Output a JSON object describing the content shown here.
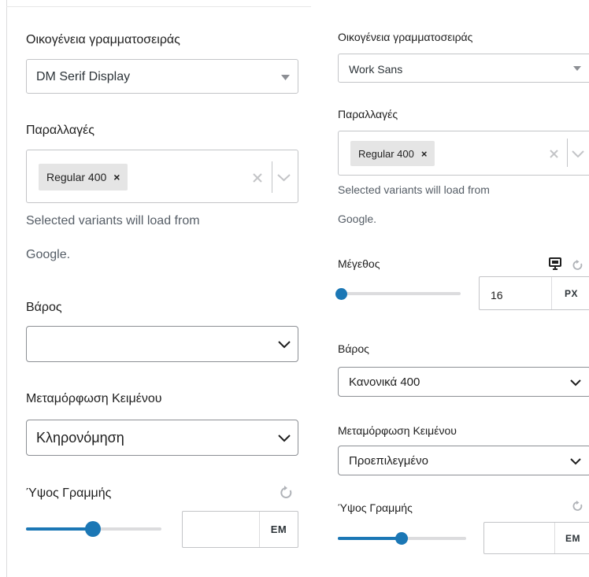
{
  "left": {
    "font_family": {
      "label": "Οικογένεια γραμματοσειράς",
      "value": "DM Serif Display"
    },
    "variants": {
      "label": "Παραλλαγές",
      "tag": "Regular 400",
      "help_line1": "Selected variants will load from",
      "help_line2": "Google."
    },
    "weight": {
      "label": "Βάρος",
      "value": ""
    },
    "transform": {
      "label": "Μεταμόρφωση Κειμένου",
      "value": "Κληρονόμηση"
    },
    "line_height": {
      "label": "Ύψος Γραμμής",
      "value": "",
      "unit": "EM",
      "slider_level": 0.5
    }
  },
  "right": {
    "font_family": {
      "label": "Οικογένεια γραμματοσειράς",
      "value": "Work Sans"
    },
    "variants": {
      "label": "Παραλλαγές",
      "tag": "Regular 400",
      "help_line1": "Selected variants will load from",
      "help_line2": "Google."
    },
    "size": {
      "label": "Μέγεθος",
      "value": "16",
      "unit": "PX",
      "slider_level": 0.0
    },
    "weight": {
      "label": "Βάρος",
      "value": "Κανονικά 400"
    },
    "transform": {
      "label": "Μεταμόρφωση Κειμένου",
      "value": "Προεπιλεγμένο"
    },
    "line_height": {
      "label": "Ύψος Γραμμής",
      "value": "",
      "unit": "EM",
      "slider_level": 0.5
    }
  },
  "colors": {
    "accent": "#1b77b5",
    "border": "#c3c4c7",
    "track": "#dcdcde"
  },
  "icons": {
    "select": "triangle-down-icon",
    "chevron": "chevron-down-icon",
    "clear": "close-icon",
    "reset": "reset-icon",
    "device": "desktop-icon"
  }
}
